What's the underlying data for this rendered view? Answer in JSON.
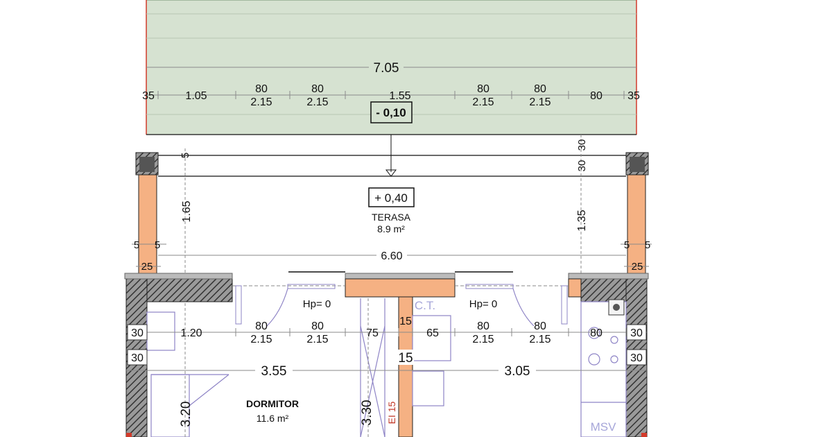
{
  "colors": {
    "terrace_fill": "#d6e2d1",
    "wall_fill": "#f5b183",
    "hatch": "#444444",
    "dim_line": "#8a8a8a",
    "furniture": "#8e84c6",
    "red_line": "#d23a2a"
  },
  "top": {
    "overall": "7.05",
    "dims": [
      "35",
      "1.05",
      "80",
      "80",
      "1.55",
      "80",
      "80",
      "80",
      "35"
    ],
    "heights": [
      "2.15",
      "2.15",
      "2.15",
      "2.15"
    ],
    "level_label": "- 0,10"
  },
  "terrace": {
    "level_label": "+ 0,40",
    "name": "TERASA",
    "area": "8.9 m²",
    "width": "6.60",
    "left_height": "1.65",
    "right_height": "1.35",
    "right_top": "30",
    "right_top2": "30",
    "small_left": "5",
    "side_5": [
      "5",
      "5",
      "5",
      "5"
    ],
    "side_25": [
      "25",
      "25"
    ]
  },
  "interior": {
    "hp_left": "Hp= 0",
    "hp_right": "Hp= 0",
    "ct": "C.T.",
    "dims": [
      "30",
      "1.20",
      "80",
      "80",
      "75",
      "15",
      "65",
      "80",
      "80",
      "80",
      "30"
    ],
    "heights": [
      "2.15",
      "2.15",
      "2.15",
      "2.15"
    ],
    "wall_30_left": "30",
    "wall_15": "15",
    "wall_30_right": "30",
    "left_width": "3.55",
    "right_width": "3.05",
    "left_height": "3.20",
    "mid_height": "3.30",
    "ei": "EI 15",
    "room_name": "DORMITOR",
    "room_area": "11.6 m²",
    "msv": "MSV"
  }
}
